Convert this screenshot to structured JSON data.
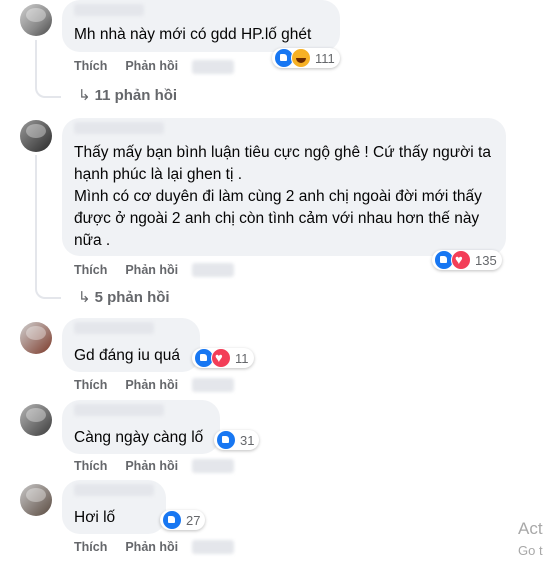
{
  "comments": [
    {
      "text": "Mh nhà này mới có gdd HP.lố ghét",
      "like_label": "Thích",
      "reply_label": "Phản hồi",
      "reaction_count": "111",
      "replies_label": "11 phản hồi"
    },
    {
      "text": "Thấy mấy bạn bình luận tiêu cực ngộ ghê ! Cứ thấy người ta hạnh phúc là lại ghen tị .\nMình có cơ duyên đi làm cùng 2 anh chị ngoài đời mới thấy được ở ngoài 2 anh chị còn tình cảm với nhau hơn thế này nữa .",
      "like_label": "Thích",
      "reply_label": "Phản hồi",
      "reaction_count": "135",
      "replies_label": "5 phản hồi"
    },
    {
      "text": "Gd đáng iu quá",
      "like_label": "Thích",
      "reply_label": "Phản hồi",
      "reaction_count": "11"
    },
    {
      "text": "Càng ngày càng lố",
      "like_label": "Thích",
      "reply_label": "Phản hồi",
      "reaction_count": "31"
    },
    {
      "text": "Hơi lố",
      "like_label": "Thích",
      "reply_label": "Phản hồi",
      "reaction_count": "27"
    }
  ],
  "watermark": {
    "line1": "Act",
    "line2": "Go t"
  },
  "colors": {
    "bubble": "#f0f2f5",
    "meta_text": "#65676b",
    "like_blue": "#1877f2",
    "love_red": "#f33e58",
    "haha_yellow": "#f7b125"
  }
}
